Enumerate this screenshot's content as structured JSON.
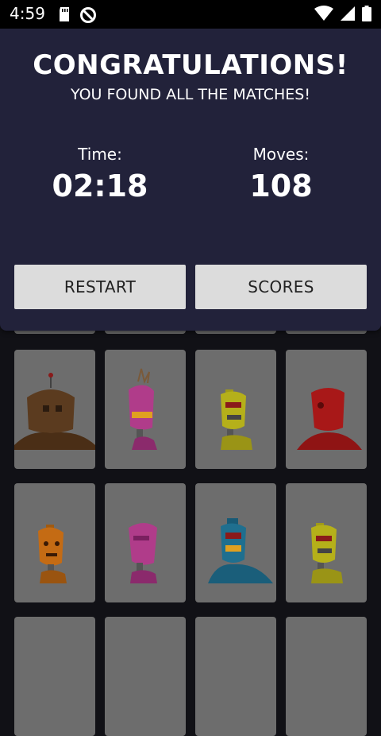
{
  "status_bar": {
    "time": "4:59"
  },
  "dialog": {
    "title": "CONGRATULATIONS!",
    "subtitle": "YOU FOUND ALL THE MATCHES!",
    "time_label": "Time:",
    "time_value": "02:18",
    "moves_label": "Moves:",
    "moves_value": "108",
    "restart_label": "RESTART",
    "scores_label": "SCORES"
  },
  "colors": {
    "dialog_bg": "#22223a",
    "card_bg": "#6d6d6d",
    "button_bg": "#dcdcdc"
  },
  "cards": [
    {
      "robot": "brown-antenna-robot",
      "color": "#5b3b1f"
    },
    {
      "robot": "pink-crest-robot",
      "color": "#b03c8a"
    },
    {
      "robot": "yellow-robot",
      "color": "#b5b01a"
    },
    {
      "robot": "red-robot",
      "color": "#a81818"
    },
    {
      "robot": "orange-robot",
      "color": "#c46b14"
    },
    {
      "robot": "pink-robot",
      "color": "#b03c8a"
    },
    {
      "robot": "blue-robot",
      "color": "#1f6f8f"
    },
    {
      "robot": "yellow-robot",
      "color": "#b5b01a"
    }
  ]
}
